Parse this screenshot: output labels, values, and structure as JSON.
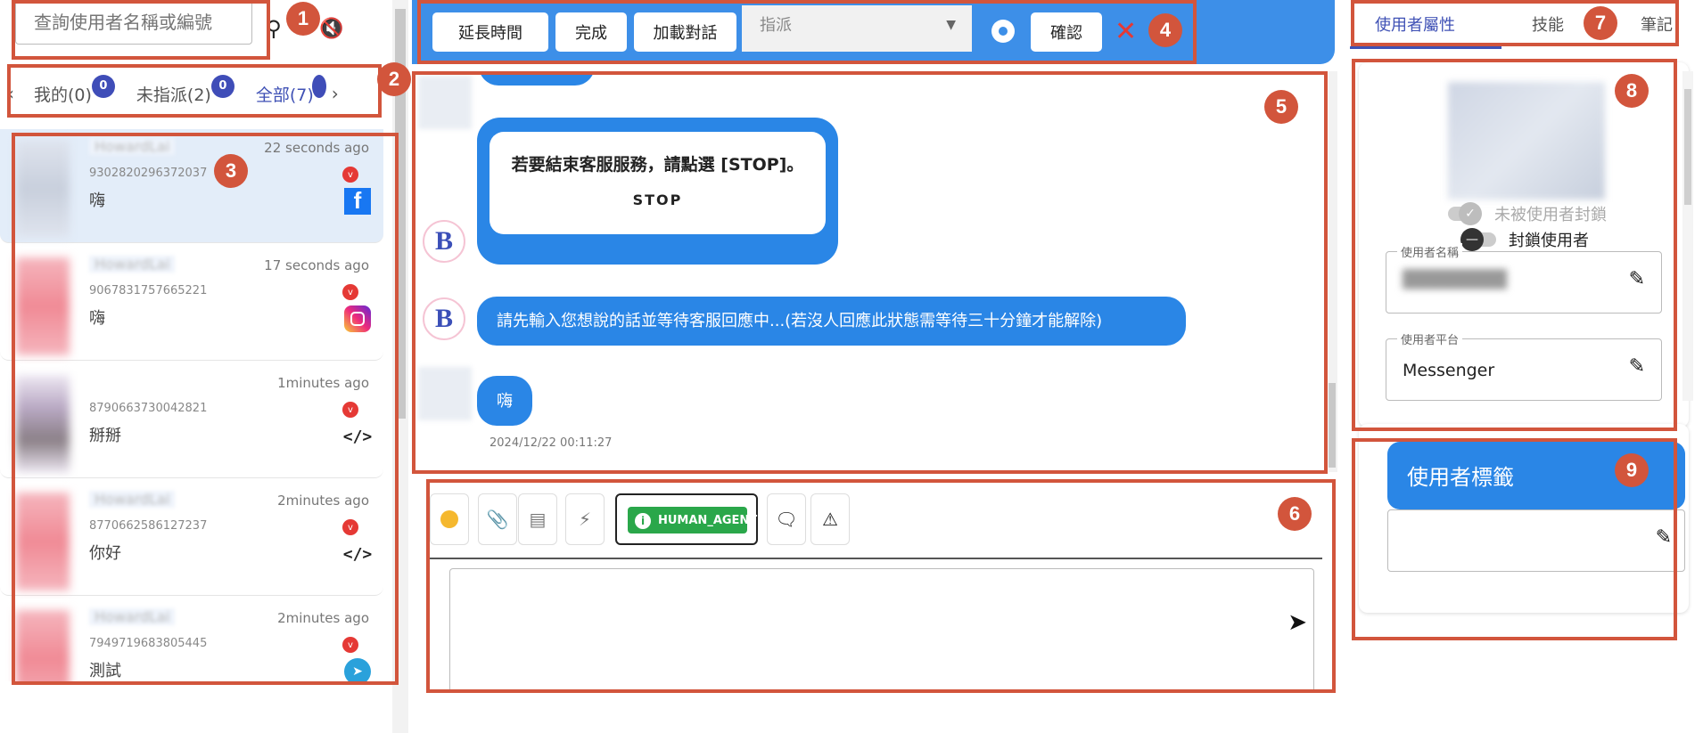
{
  "left": {
    "search_placeholder": "查詢使用者名稱或編號",
    "tabs": [
      {
        "label": "我的(0)",
        "count": "0"
      },
      {
        "label": "未指派(2)",
        "count": "0"
      },
      {
        "label": "全部(7)",
        "count": ""
      }
    ],
    "conversations": [
      {
        "name": "HowardLai",
        "time": "22 seconds ago",
        "uid": "9302820296372037",
        "msg": "嗨",
        "platform": "facebook",
        "v": "v"
      },
      {
        "name": "HowardLai",
        "time": "17 seconds ago",
        "uid": "9067831757665221",
        "msg": "嗨",
        "platform": "instagram",
        "v": "v"
      },
      {
        "name": "",
        "time": "1minutes ago",
        "uid": "8790663730042821",
        "msg": "掰掰",
        "platform": "code",
        "v": "v"
      },
      {
        "name": "HowardLai",
        "time": "2minutes ago",
        "uid": "8770662586127237",
        "msg": "你好",
        "platform": "code",
        "v": "v"
      },
      {
        "name": "HowardLai",
        "time": "2minutes ago",
        "uid": "7949719683805445",
        "msg": "測試",
        "platform": "telegram",
        "v": "v"
      }
    ]
  },
  "topbar": {
    "extend_label": "延長時間",
    "done_label": "完成",
    "load_label": "加載對話",
    "assign_label": "指派",
    "confirm_label": "確認"
  },
  "chat": {
    "card_text": "若要結束客服服務，請點選 [STOP]。",
    "card_button": "STOP",
    "bot_msg": "請先輸入您想說的話並等待客服回應中...(若沒人回應此狀態需等待三十分鐘才能解除)",
    "user_msg": "嗨",
    "timestamp": "2024/12/22 00:11:27",
    "bot_avatar_letter": "B"
  },
  "composer": {
    "human_agent_label": "HUMAN_AGENT"
  },
  "right": {
    "tabs": [
      "使用者屬性",
      "技能",
      "筆記"
    ],
    "unblocked_label": "未被使用者封鎖",
    "block_label": "封鎖使用者",
    "username_legend": "使用者名稱",
    "platform_legend": "使用者平台",
    "platform_value": "Messenger",
    "tag_title": "使用者標籤"
  },
  "annotations": [
    "1",
    "2",
    "3",
    "4",
    "5",
    "6",
    "7",
    "8",
    "9"
  ],
  "colors": {
    "accent": "#3d8fe8",
    "annotation": "#d2553c",
    "tab_active": "#3f51b5",
    "badge": "#3f4db8"
  }
}
